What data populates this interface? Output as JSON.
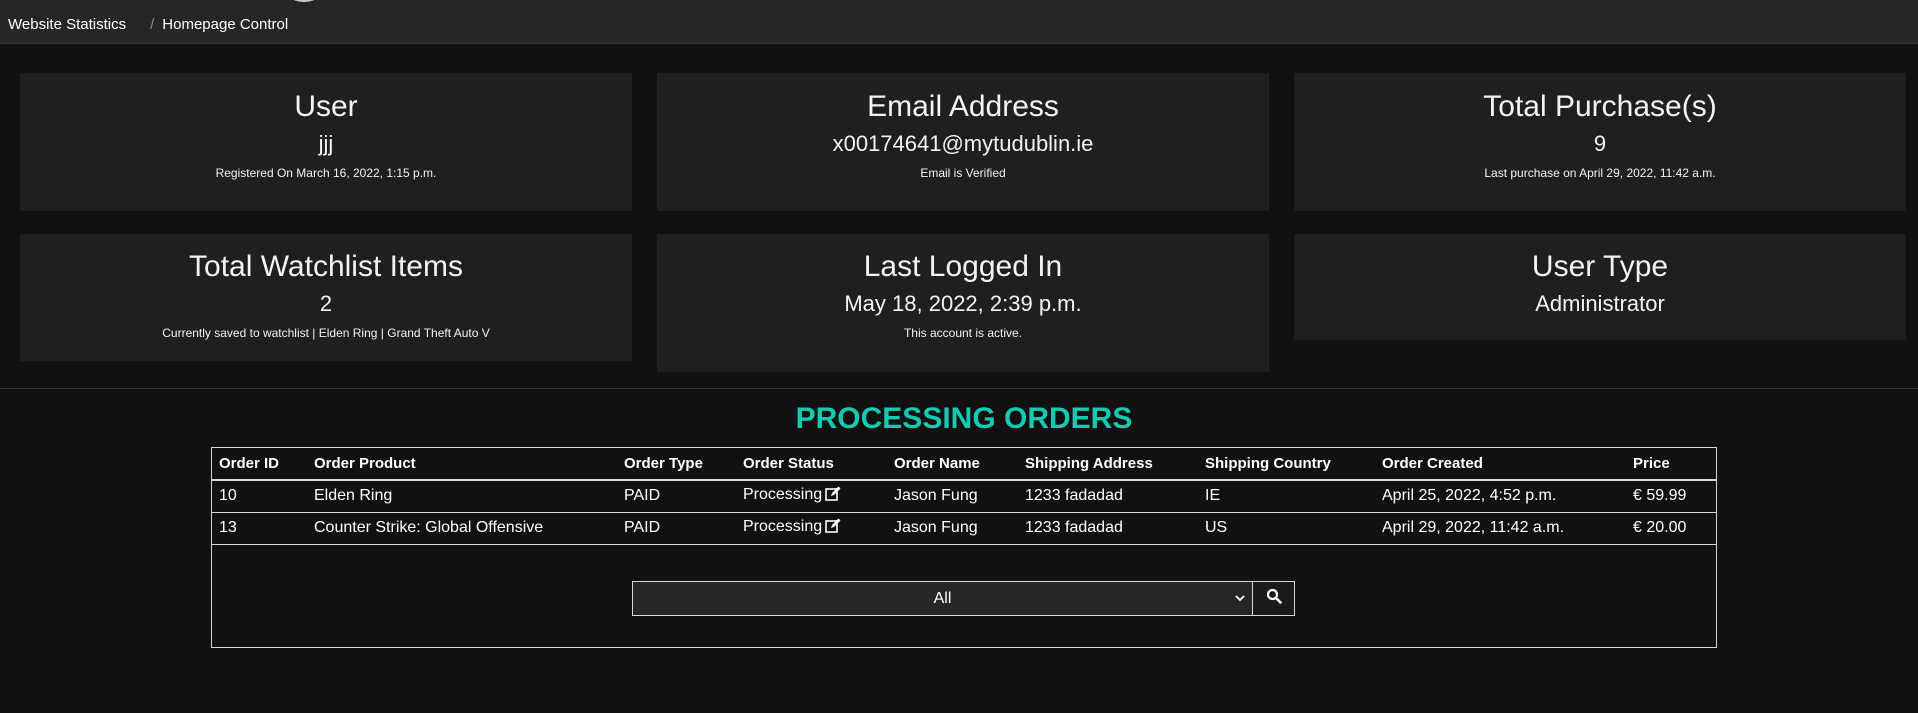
{
  "breadcrumb": {
    "items": [
      "Website Statistics",
      "Homepage Control"
    ],
    "separator": "/"
  },
  "cards": {
    "user": {
      "title": "User",
      "value": "jjj",
      "sub": "Registered On March 16, 2022, 1:15 p.m."
    },
    "email": {
      "title": "Email Address",
      "value": "x00174641@mytudublin.ie",
      "sub": "Email is Verified"
    },
    "purchases": {
      "title": "Total Purchase(s)",
      "value": "9",
      "sub": "Last purchase on April 29, 2022, 11:42 a.m."
    },
    "watchlist": {
      "title": "Total Watchlist Items",
      "value": "2",
      "sub": "Currently saved to watchlist | Elden Ring | Grand Theft Auto V"
    },
    "last_login": {
      "title": "Last Logged In",
      "value": "May 18, 2022, 2:39 p.m.",
      "sub": "This account is active."
    },
    "user_type": {
      "title": "User Type",
      "value": "Administrator"
    }
  },
  "orders": {
    "title": "PROCESSING ORDERS",
    "columns": [
      "Order ID",
      "Order Product",
      "Order Type",
      "Order Status",
      "Order Name",
      "Shipping Address",
      "Shipping Country",
      "Order Created",
      "Price"
    ],
    "rows": [
      [
        "10",
        "Elden Ring",
        "PAID",
        "Processing",
        "Jason Fung",
        "1233 fadadad",
        "IE",
        "April 25, 2022, 4:52 p.m.",
        "€ 59.99"
      ],
      [
        "13",
        "Counter Strike: Global Offensive",
        "PAID",
        "Processing",
        "Jason Fung",
        "1233 fadadad",
        "US",
        "April 29, 2022, 11:42 a.m.",
        "€ 20.00"
      ]
    ]
  },
  "filter": {
    "selected": "All",
    "icons": {
      "chevron": "chevron-down-icon",
      "search": "search-icon",
      "edit": "edit-icon"
    }
  },
  "colors": {
    "accent": "#17c9b0",
    "background": "#111111",
    "card": "#1f1f1f",
    "topbar": "#262626"
  }
}
